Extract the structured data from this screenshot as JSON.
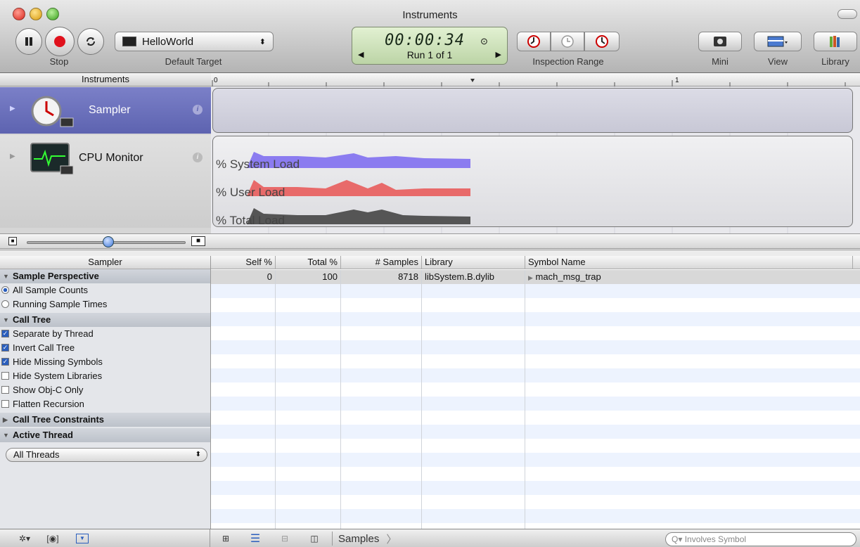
{
  "window": {
    "title": "Instruments"
  },
  "toolbar": {
    "stop_label": "Stop",
    "target_name": "HelloWorld",
    "target_label": "Default Target",
    "timer": "00:00:34",
    "run_label": "Run 1 of 1",
    "inspection_label": "Inspection Range",
    "mini_label": "Mini",
    "view_label": "View",
    "library_label": "Library"
  },
  "instruments_header": "Instruments",
  "ruler": {
    "tick_start": "0",
    "tick_end": "1"
  },
  "instruments": [
    {
      "name": "Sampler"
    },
    {
      "name": "CPU Monitor"
    }
  ],
  "cpu_graphs": [
    {
      "label": "% System Load",
      "color": "#8b7cf0"
    },
    {
      "label": "% User Load",
      "color": "#e86a6a"
    },
    {
      "label": "% Total Load",
      "color": "#555555"
    }
  ],
  "sidebar": {
    "header": "Sampler",
    "sections": {
      "sample_perspective": {
        "title": "Sample Perspective",
        "options": [
          {
            "label": "All Sample Counts",
            "selected": true
          },
          {
            "label": "Running Sample Times",
            "selected": false
          }
        ]
      },
      "call_tree": {
        "title": "Call Tree",
        "options": [
          {
            "label": "Separate by Thread",
            "checked": true
          },
          {
            "label": "Invert Call Tree",
            "checked": true
          },
          {
            "label": "Hide Missing Symbols",
            "checked": true
          },
          {
            "label": "Hide System Libraries",
            "checked": false
          },
          {
            "label": "Show Obj-C Only",
            "checked": false
          },
          {
            "label": "Flatten Recursion",
            "checked": false
          }
        ]
      },
      "constraints_title": "Call Tree Constraints",
      "active_thread_title": "Active Thread",
      "thread_select": "All Threads"
    }
  },
  "table": {
    "columns": [
      "Self %",
      "Total %",
      "# Samples",
      "Library",
      "Symbol Name"
    ],
    "rows": [
      {
        "self": "0",
        "total": "100",
        "samples": "8718",
        "library": "libSystem.B.dylib",
        "symbol": "mach_msg_trap"
      }
    ]
  },
  "bottombar": {
    "breadcrumb": "Samples",
    "search_placeholder": "Involves Symbol"
  }
}
